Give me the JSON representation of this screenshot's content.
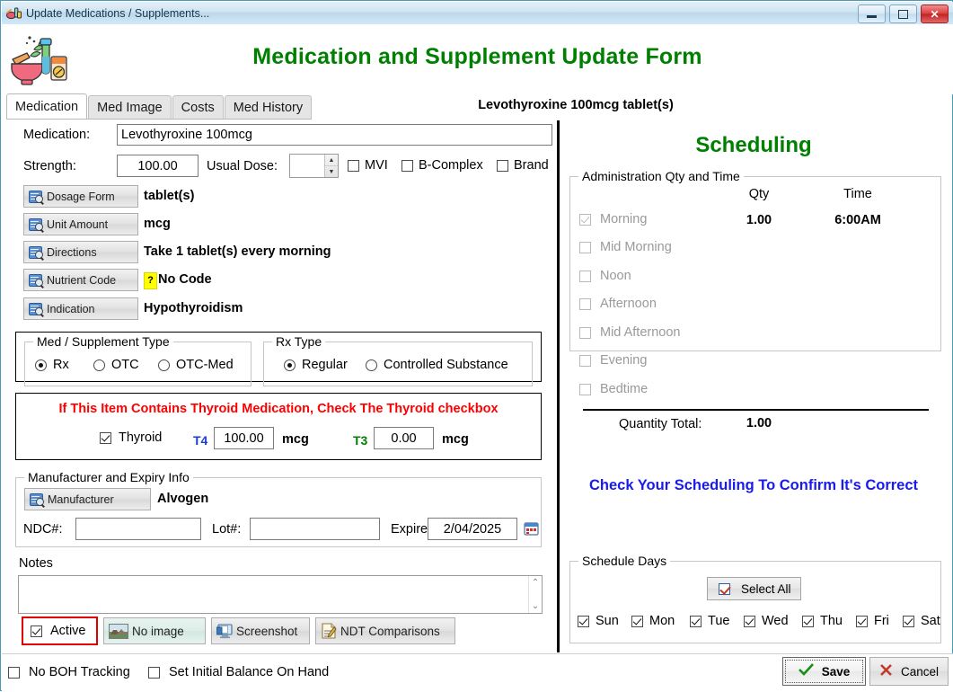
{
  "window": {
    "title": "Update Medications / Supplements...",
    "app_icon": "mortar-pestle-supplement-icon",
    "buttons": {
      "minimize": "minimize-icon",
      "maximize": "maximize-icon",
      "close": "close-icon"
    }
  },
  "header": {
    "title": "Medication and Supplement Update Form"
  },
  "tabs": [
    {
      "label": "Medication",
      "active": true
    },
    {
      "label": "Med Image",
      "active": false
    },
    {
      "label": "Costs",
      "active": false
    },
    {
      "label": "Med History",
      "active": false
    }
  ],
  "med_header": "Levothyroxine 100mcg tablet(s)",
  "left": {
    "medication_label": "Medication:",
    "medication_value": "Levothyroxine 100mcg",
    "strength_label": "Strength:",
    "strength_value": "100.00",
    "usual_dose_label": "Usual Dose:",
    "usual_dose_value": "",
    "mvi_label": "MVI",
    "mvi_checked": false,
    "bcomplex_label": "B-Complex",
    "bcomplex_checked": false,
    "brand_label": "Brand",
    "brand_checked": false,
    "lookups": [
      {
        "button": "Dosage Form",
        "value": "tablet(s)"
      },
      {
        "button": "Unit Amount",
        "value": "mcg"
      },
      {
        "button": "Directions",
        "value": "Take 1 tablet(s) every morning"
      },
      {
        "button": "Nutrient Code",
        "value": "No Code",
        "badge": "?"
      },
      {
        "button": "Indication",
        "value": "Hypothyroidism"
      }
    ],
    "med_type": {
      "caption": "Med / Supplement Type",
      "options": [
        {
          "label": "Rx",
          "selected": true
        },
        {
          "label": "OTC",
          "selected": false
        },
        {
          "label": "OTC-Med",
          "selected": false
        }
      ]
    },
    "rx_type": {
      "caption": "Rx Type",
      "options": [
        {
          "label": "Regular",
          "selected": true
        },
        {
          "label": "Controlled Substance",
          "selected": false
        }
      ]
    },
    "thyroid": {
      "warning": "If This Item Contains Thyroid Medication, Check The Thyroid checkbox",
      "warning_color": "#ff0000",
      "checkbox_label": "Thyroid",
      "checked": true,
      "t4_label": "T4",
      "t4_color": "#1a3fd0",
      "t4_value": "100.00",
      "t4_unit": "mcg",
      "t3_label": "T3",
      "t3_color": "#008000",
      "t3_value": "0.00",
      "t3_unit": "mcg"
    },
    "manufacturer": {
      "caption": "Manufacturer and Expiry Info",
      "button": "Manufacturer",
      "value": "Alvogen",
      "ndc_label": "NDC#:",
      "ndc_value": "",
      "lot_label": "Lot#:",
      "lot_value": "",
      "expires_label": "Expires:",
      "expires_value": "2/04/2025",
      "calendar_icon": "calendar-icon"
    },
    "notes_label": "Notes",
    "notes_value": "",
    "active_label": "Active",
    "active_checked": true,
    "image_button": "No image",
    "screenshot_button": "Screenshot",
    "ndt_button": "NDT Comparisons"
  },
  "right": {
    "heading": "Scheduling",
    "heading_color": "#008000",
    "admin_caption": "Administration Qty and Time",
    "col_qty": "Qty",
    "col_time": "Time",
    "slots": [
      {
        "label": "Morning",
        "checked": true,
        "qty": "1.00",
        "time": "6:00AM"
      },
      {
        "label": "Mid Morning",
        "checked": false,
        "qty": "",
        "time": ""
      },
      {
        "label": "Noon",
        "checked": false,
        "qty": "",
        "time": ""
      },
      {
        "label": "Afternoon",
        "checked": false,
        "qty": "",
        "time": ""
      },
      {
        "label": "Mid Afternoon",
        "checked": false,
        "qty": "",
        "time": ""
      },
      {
        "label": "Evening",
        "checked": false,
        "qty": "",
        "time": ""
      },
      {
        "label": "Bedtime",
        "checked": false,
        "qty": "",
        "time": ""
      }
    ],
    "qty_total_label": "Quantity Total:",
    "qty_total_value": "1.00",
    "confirm_text": "Check Your Scheduling To Confirm It's Correct",
    "confirm_color": "#1a1aee",
    "days_caption": "Schedule Days",
    "select_all_label": "Select All",
    "select_all_checked": true,
    "days": [
      {
        "label": "Sun",
        "checked": true
      },
      {
        "label": "Mon",
        "checked": true
      },
      {
        "label": "Tue",
        "checked": true
      },
      {
        "label": "Wed",
        "checked": true
      },
      {
        "label": "Thu",
        "checked": true
      },
      {
        "label": "Fri",
        "checked": true
      },
      {
        "label": "Sat",
        "checked": true
      }
    ]
  },
  "footer": {
    "no_boh_label": "No BOH Tracking",
    "no_boh_checked": false,
    "set_initial_label": "Set Initial Balance On Hand",
    "set_initial_checked": false,
    "save_label": "Save",
    "cancel_label": "Cancel"
  }
}
